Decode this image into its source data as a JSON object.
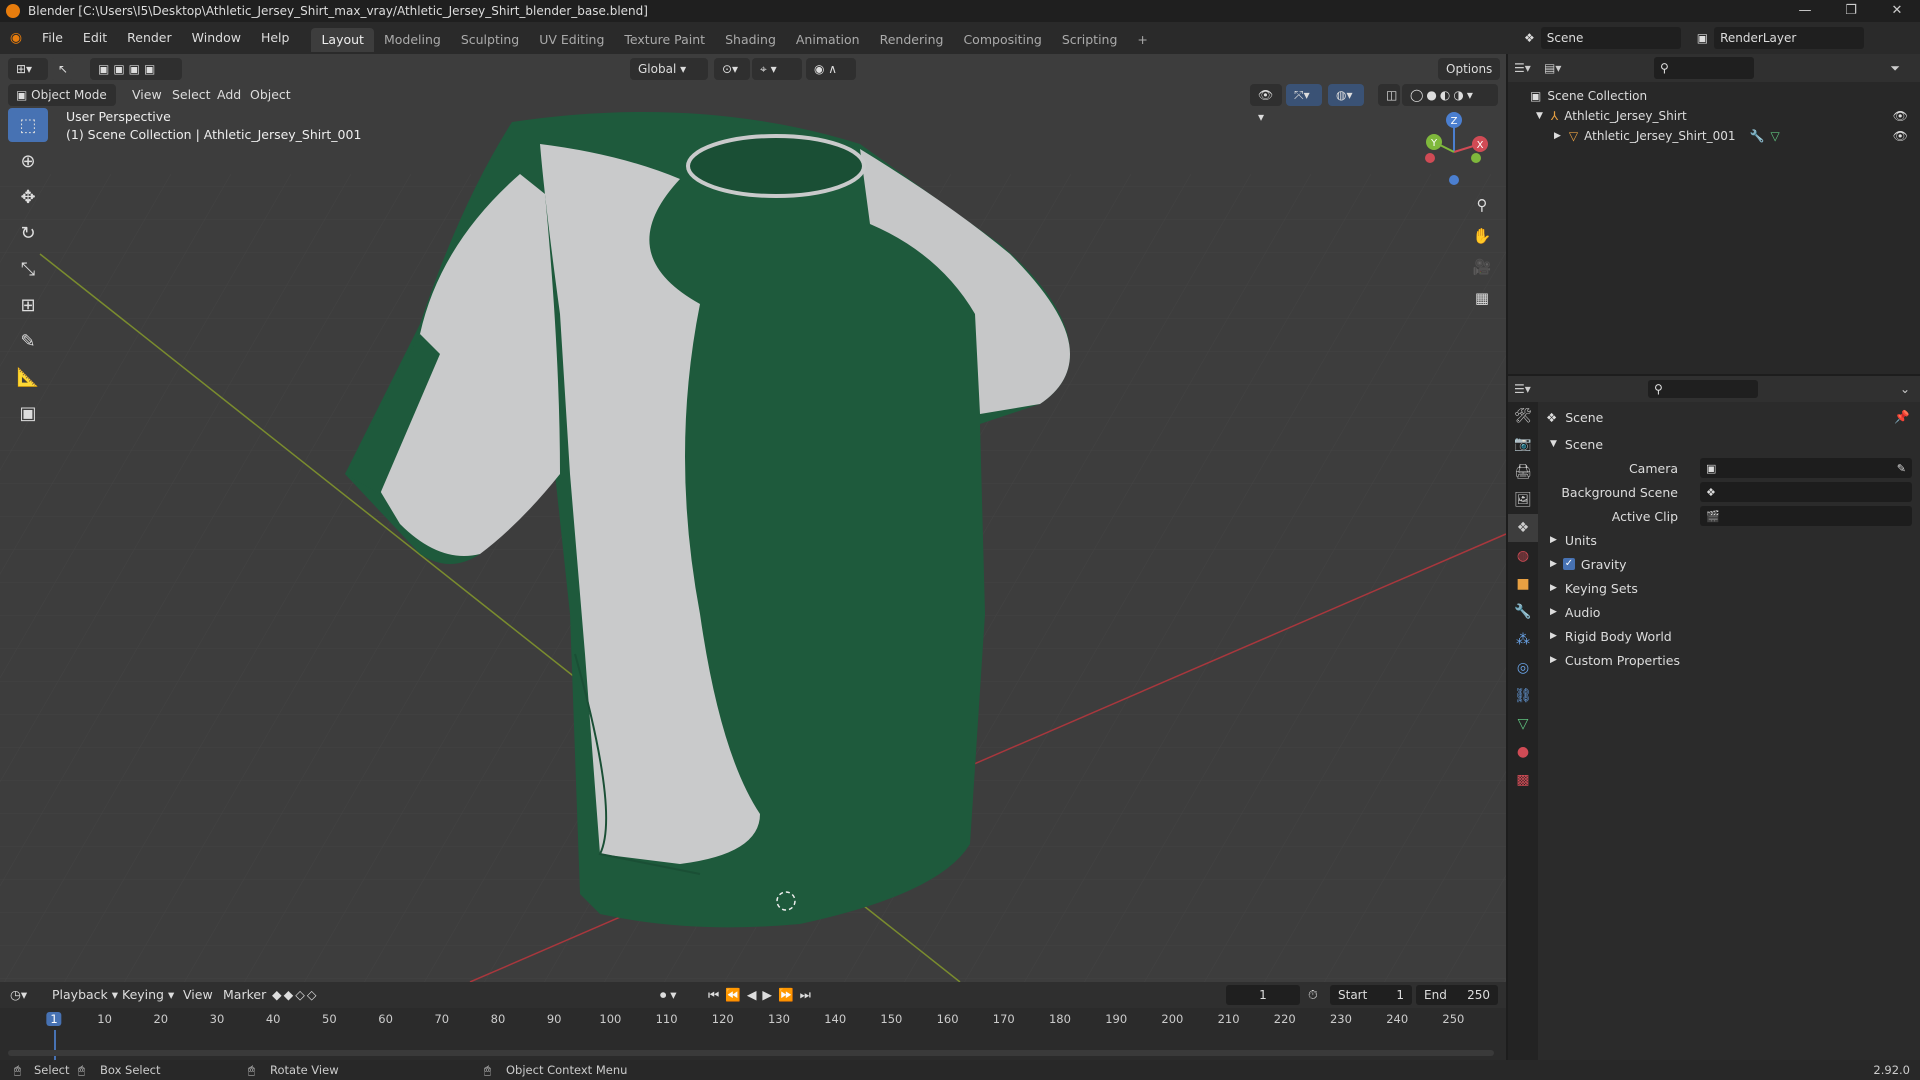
{
  "window": {
    "title": "Blender [C:\\Users\\I5\\Desktop\\Athletic_Jersey_Shirt_max_vray/Athletic_Jersey_Shirt_blender_base.blend]",
    "controls": [
      "—",
      "❐",
      "✕"
    ]
  },
  "menu": {
    "items": [
      "File",
      "Edit",
      "Render",
      "Window",
      "Help"
    ],
    "workspaces": [
      "Layout",
      "Modeling",
      "Sculpting",
      "UV Editing",
      "Texture Paint",
      "Shading",
      "Animation",
      "Rendering",
      "Compositing",
      "Scripting"
    ],
    "active_workspace": "Layout",
    "add_tab": "+",
    "scene": "Scene",
    "render_layer": "RenderLayer"
  },
  "viewport": {
    "mode": "Object Mode",
    "menus": [
      "View",
      "Select",
      "Add",
      "Object"
    ],
    "transform_orientation": "Global",
    "options": "Options",
    "perspective": "User Perspective",
    "collection_info": "(1) Scene Collection | Athletic_Jersey_Shirt_001",
    "gizmo": {
      "x": "X",
      "y": "Y",
      "z": "Z"
    },
    "colors": {
      "jersey_green": "#1e5a3c",
      "jersey_white": "#c9cacb",
      "background": "#3d3d3d"
    }
  },
  "outliner": {
    "root": "Scene Collection",
    "items": [
      {
        "label": "Athletic_Jersey_Shirt"
      },
      {
        "label": "Athletic_Jersey_Shirt_001"
      }
    ]
  },
  "properties": {
    "context": "Scene",
    "section": "Scene",
    "fields": [
      {
        "label": "Camera",
        "value": ""
      },
      {
        "label": "Background Scene",
        "value": ""
      },
      {
        "label": "Active Clip",
        "value": ""
      }
    ],
    "panels": [
      "Units",
      "Gravity",
      "Keying Sets",
      "Audio",
      "Rigid Body World",
      "Custom Properties"
    ]
  },
  "timeline": {
    "menus": [
      "Playback",
      "Keying",
      "View",
      "Marker"
    ],
    "current_frame": "1",
    "start_label": "Start",
    "start": "1",
    "end_label": "End",
    "end": "250",
    "ruler": [
      "1",
      "10",
      "20",
      "30",
      "40",
      "50",
      "60",
      "70",
      "80",
      "90",
      "100",
      "110",
      "120",
      "130",
      "140",
      "150",
      "160",
      "170",
      "180",
      "190",
      "200",
      "210",
      "220",
      "230",
      "240",
      "250"
    ]
  },
  "status": {
    "select": "Select",
    "box_select": "Box Select",
    "rotate_view": "Rotate View",
    "context_menu": "Object Context Menu",
    "version": "2.92.0"
  }
}
